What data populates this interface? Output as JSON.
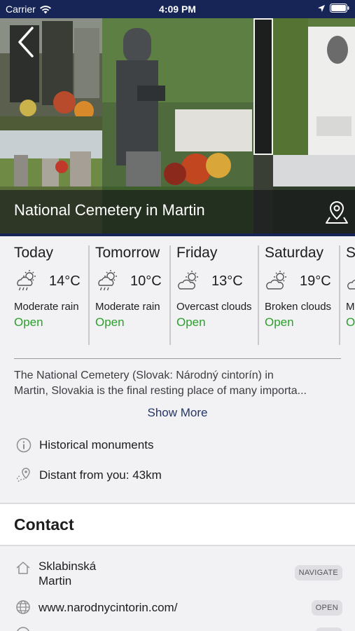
{
  "status_bar": {
    "carrier": "Carrier",
    "time": "4:09 PM"
  },
  "place": {
    "title": "National Cemetery in Martin"
  },
  "weather": [
    {
      "day": "Today",
      "temp": "14°C",
      "condition": "Moderate rain",
      "status": "Open",
      "icon": "rain-cloud-sun-icon"
    },
    {
      "day": "Tomorrow",
      "temp": "10°C",
      "condition": "Moderate rain",
      "status": "Open",
      "icon": "rain-cloud-sun-icon"
    },
    {
      "day": "Friday",
      "temp": "13°C",
      "condition": "Overcast clouds",
      "status": "Open",
      "icon": "cloud-sun-icon"
    },
    {
      "day": "Saturday",
      "temp": "19°C",
      "condition": "Broken clouds",
      "status": "Open",
      "icon": "cloud-sun-icon"
    },
    {
      "day": "S",
      "temp": "",
      "condition": "M",
      "status": "O",
      "icon": "cloud-sun-icon"
    }
  ],
  "description": {
    "line1": "The National Cemetery (Slovak: Národný cintorín) in",
    "line2": "Martin, Slovakia is the final resting place of many importa...",
    "show_more": "Show More"
  },
  "info": {
    "category": "Historical monuments",
    "distance": "Distant from you: 43km"
  },
  "contact": {
    "title": "Contact",
    "address_line1": "Sklabinská",
    "address_line2": "Martin",
    "navigate_label": "NAVIGATE",
    "website": "www.narodnycintorin.com/",
    "open_label": "OPEN"
  },
  "colors": {
    "nav": "#172556",
    "open_green": "#2aa02a",
    "link": "#243467"
  }
}
